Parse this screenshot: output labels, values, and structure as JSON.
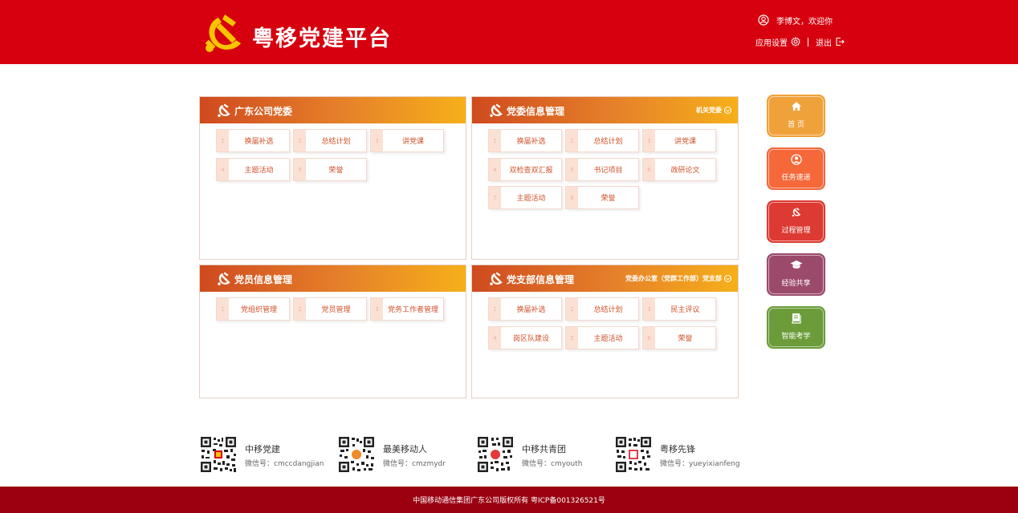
{
  "header": {
    "title": "粤移党建平台",
    "welcome": "李博文，欢迎你",
    "settings": "应用设置",
    "logout": "退出"
  },
  "panels": [
    {
      "title": "广东公司党委",
      "right": "",
      "items": [
        {
          "num": "1",
          "label": "换届补选"
        },
        {
          "num": "2",
          "label": "总结计划"
        },
        {
          "num": "3",
          "label": "讲党课"
        },
        {
          "num": "4",
          "label": "主题活动"
        },
        {
          "num": "5",
          "label": "荣誉"
        }
      ]
    },
    {
      "title": "党委信息管理",
      "right": "机关党委",
      "items": [
        {
          "num": "1",
          "label": "换届补选"
        },
        {
          "num": "2",
          "label": "总结计划"
        },
        {
          "num": "3",
          "label": "讲党课"
        },
        {
          "num": "4",
          "label": "双检查双汇报"
        },
        {
          "num": "5",
          "label": "书记项目"
        },
        {
          "num": "6",
          "label": "政研论文"
        },
        {
          "num": "7",
          "label": "主题活动"
        },
        {
          "num": "8",
          "label": "荣誉"
        }
      ]
    },
    {
      "title": "党员信息管理",
      "right": "",
      "items": [
        {
          "num": "1",
          "label": "党组织管理"
        },
        {
          "num": "2",
          "label": "党员管理"
        },
        {
          "num": "3",
          "label": "党务工作者管理"
        }
      ]
    },
    {
      "title": "党支部信息管理",
      "right": "党委办公室（党群工作部）党支部",
      "items": [
        {
          "num": "1",
          "label": "换届补选"
        },
        {
          "num": "2",
          "label": "总结计划"
        },
        {
          "num": "3",
          "label": "民主评议"
        },
        {
          "num": "4",
          "label": "岗区队建设"
        },
        {
          "num": "5",
          "label": "主题活动"
        },
        {
          "num": "6",
          "label": "荣誉"
        }
      ]
    }
  ],
  "side_nav": [
    {
      "label": "首 页",
      "icon": "home-icon",
      "color": "#f0a23a"
    },
    {
      "label": "任务速递",
      "icon": "user-icon",
      "color": "#f4683a"
    },
    {
      "label": "过程管理",
      "icon": "party-emblem-icon",
      "color": "#dc3a32"
    },
    {
      "label": "经验共享",
      "icon": "graduation-cap-icon",
      "color": "#9c4a6c"
    },
    {
      "label": "智能考学",
      "icon": "book-icon",
      "color": "#6c9c3a"
    }
  ],
  "qr_codes": [
    {
      "name": "中移党建",
      "id": "微信号：cmccdangjian"
    },
    {
      "name": "最美移动人",
      "id": "微信号：cmzmydr"
    },
    {
      "name": "中移共青团",
      "id": "微信号：cmyouth"
    },
    {
      "name": "粤移先锋",
      "id": "微信号：yueyixianfeng"
    }
  ],
  "footer": {
    "copyright": "中国移动通信集团广东公司版权所有 粤ICP备001326521号"
  },
  "colors": {
    "brand_red": "#d7000f",
    "footer_red": "#9a0010",
    "gold": "#f6c400"
  }
}
